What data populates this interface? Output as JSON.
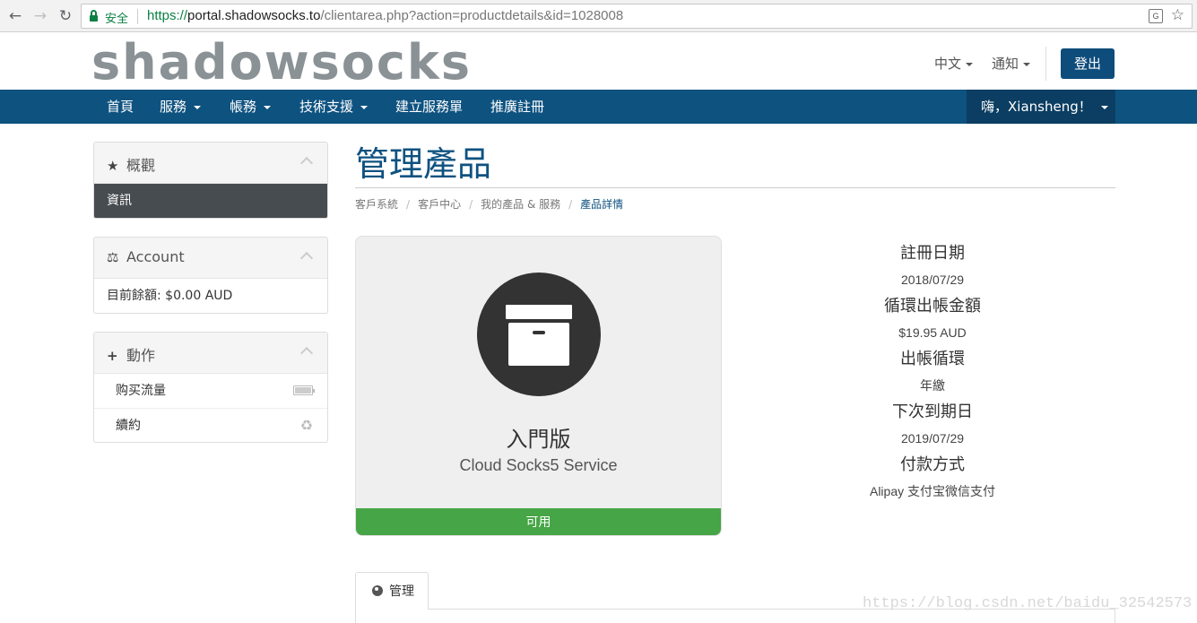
{
  "browser": {
    "secure_label": "安全",
    "url_protocol": "https://",
    "url_host": "portal.shadowsocks.to",
    "url_path": "/clientarea.php?action=productdetails&id=1028008",
    "translate_glyph": "G"
  },
  "header": {
    "logo": "shadowsocks",
    "language": "中文",
    "notifications": "通知",
    "logout": "登出"
  },
  "nav": {
    "items": [
      "首頁",
      "服務",
      "帳務",
      "技術支援",
      "建立服務單",
      "推廣註冊"
    ],
    "greeting": "嗨，Xiansheng！"
  },
  "sidebar": {
    "overview": {
      "title": "概觀",
      "items": [
        "資訊"
      ]
    },
    "account": {
      "title": "Account",
      "balance": "目前餘額: $0.00 AUD"
    },
    "actions": {
      "title": "動作",
      "items": [
        "购买流量",
        "續約"
      ]
    }
  },
  "page": {
    "title": "管理產品",
    "breadcrumb": [
      "客戶系統",
      "客戶中心",
      "我的產品 & 服務",
      "產品詳情"
    ]
  },
  "product": {
    "name": "入門版",
    "group": "Cloud Socks5 Service",
    "status": "可用",
    "status_color": "#46a546"
  },
  "details": [
    {
      "label": "註冊日期",
      "value": "2018/07/29"
    },
    {
      "label": "循環出帳金額",
      "value": "$19.95 AUD"
    },
    {
      "label": "出帳循環",
      "value": "年繳"
    },
    {
      "label": "下次到期日",
      "value": "2019/07/29"
    },
    {
      "label": "付款方式",
      "value": "Alipay 支付宝微信支付"
    }
  ],
  "tabs": {
    "manage": "管理"
  },
  "watermark": "https://blog.csdn.net/baidu_32542573",
  "colors": {
    "brand": "#0e5280",
    "nav_dark": "#0b3e62",
    "active_row": "#474c50"
  }
}
